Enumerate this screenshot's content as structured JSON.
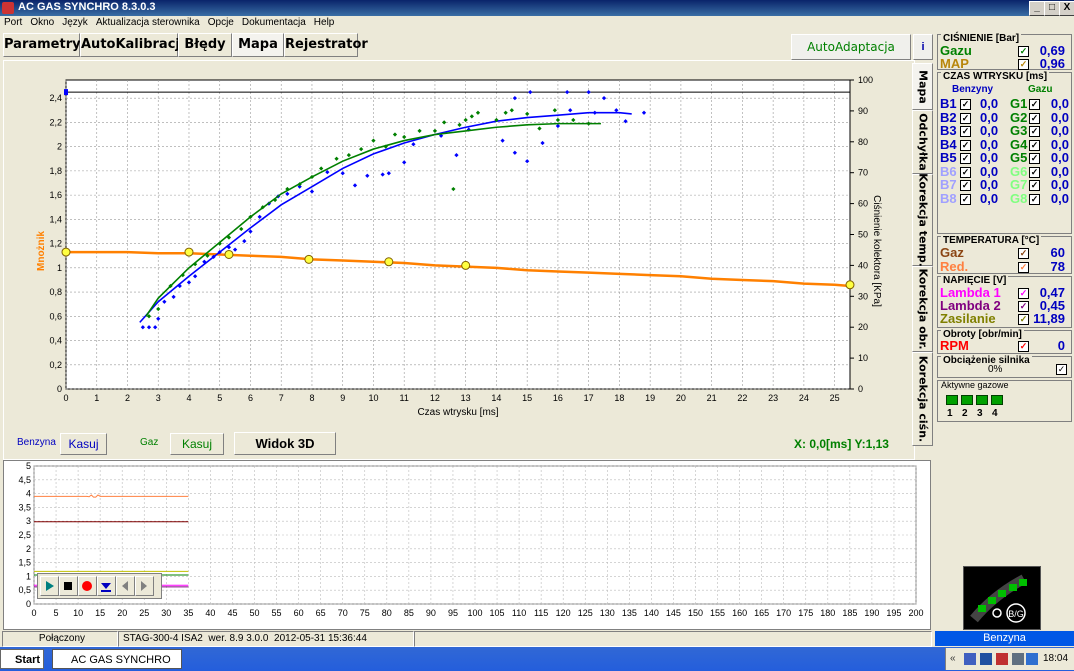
{
  "window": {
    "title": "AC GAS SYNCHRO  8.3.0.3",
    "btn_min": "_",
    "btn_max": "□",
    "btn_close": "X"
  },
  "menu": [
    "Port",
    "Okno",
    "Język",
    "Aktualizacja sterownika",
    "Opcje",
    "Dokumentacja",
    "Help"
  ],
  "tabs": [
    "Parametry",
    "AutoKalibracja",
    "Błędy",
    "Mapa",
    "Rejestrator"
  ],
  "active_tab": "Mapa",
  "autoadaptacja": "AutoAdaptacja",
  "info_btn": "i",
  "vtabs": [
    "Mapa",
    "Odchyłka",
    "Korekcja temp.",
    "Korekcja obr.",
    "Korekcja ciśn."
  ],
  "chart_labels": {
    "ylabel": "Mnożnik",
    "y2label": "Ciśnienie kolektora [KPa]",
    "xlabel": "Czas wtrysku [ms]"
  },
  "chart_controls": {
    "benzyna_label": "Benzyna",
    "kasuj1": "Kasuj",
    "gaz_label": "Gaz",
    "kasuj2": "Kasuj",
    "widok3d": "Widok 3D",
    "coords": "X:  0,0[ms] Y:1,13"
  },
  "chart_data": {
    "type": "scatter",
    "x_ticks": [
      0,
      1,
      2,
      3,
      4,
      5,
      6,
      7,
      8,
      9,
      10,
      11,
      12,
      13,
      14,
      15,
      16,
      17,
      18,
      19,
      20,
      21,
      22,
      23,
      24,
      25
    ],
    "y_ticks": [
      "0",
      "0,2",
      "0,4",
      "0,6",
      "0,8",
      "1",
      "1,2",
      "1,4",
      "1,6",
      "1,8",
      "2",
      "2,2",
      "2,4"
    ],
    "y2_ticks": [
      0,
      10,
      20,
      30,
      40,
      50,
      60,
      70,
      80,
      90,
      100
    ],
    "xlim": [
      0,
      25.5
    ],
    "ylim": [
      0,
      2.55
    ],
    "y2lim": [
      0,
      100
    ],
    "series": [
      {
        "color": "#0000FF",
        "trend": [
          [
            2.4,
            0.55
          ],
          [
            3,
            0.72
          ],
          [
            4,
            0.93
          ],
          [
            5,
            1.13
          ],
          [
            6,
            1.33
          ],
          [
            7,
            1.52
          ],
          [
            8,
            1.67
          ],
          [
            9,
            1.82
          ],
          [
            10,
            1.94
          ],
          [
            11,
            2.03
          ],
          [
            12,
            2.1
          ],
          [
            13,
            2.16
          ],
          [
            14,
            2.21
          ],
          [
            15,
            2.24
          ],
          [
            16,
            2.26
          ],
          [
            17,
            2.28
          ],
          [
            18,
            2.28
          ],
          [
            18.4,
            2.27
          ]
        ],
        "points": [
          [
            2.5,
            0.51
          ],
          [
            2.7,
            0.51
          ],
          [
            2.9,
            0.51
          ],
          [
            3,
            0.58
          ],
          [
            3.2,
            0.72
          ],
          [
            3.5,
            0.76
          ],
          [
            3.7,
            0.85
          ],
          [
            4,
            0.88
          ],
          [
            4.2,
            0.93
          ],
          [
            4.5,
            1.05
          ],
          [
            4.8,
            1.09
          ],
          [
            5,
            1.13
          ],
          [
            5.3,
            1.17
          ],
          [
            5.5,
            1.15
          ],
          [
            5.8,
            1.22
          ],
          [
            6,
            1.3
          ],
          [
            6.3,
            1.42
          ],
          [
            6.6,
            1.53
          ],
          [
            6.9,
            1.59
          ],
          [
            7.2,
            1.61
          ],
          [
            7.6,
            1.67
          ],
          [
            8,
            1.63
          ],
          [
            8.5,
            1.79
          ],
          [
            9,
            1.78
          ],
          [
            9.4,
            1.68
          ],
          [
            9.8,
            1.76
          ],
          [
            10.3,
            1.77
          ],
          [
            10.5,
            1.78
          ],
          [
            11,
            1.87
          ],
          [
            11.3,
            2.02
          ],
          [
            12.2,
            2.09
          ],
          [
            12.7,
            1.93
          ],
          [
            13.1,
            2.14
          ],
          [
            14.2,
            2.05
          ],
          [
            14.6,
            1.95
          ],
          [
            15,
            1.88
          ],
          [
            15.5,
            2.03
          ],
          [
            16,
            2.17
          ],
          [
            16.4,
            2.3
          ],
          [
            17.2,
            2.28
          ],
          [
            17.5,
            2.4
          ],
          [
            17.9,
            2.3
          ],
          [
            18.2,
            2.21
          ],
          [
            14.6,
            2.4
          ],
          [
            15.1,
            2.45
          ],
          [
            16.3,
            2.45
          ],
          [
            17,
            2.45
          ],
          [
            18.8,
            2.28
          ]
        ]
      },
      {
        "color": "#008000",
        "trend": [
          [
            2.6,
            0.6
          ],
          [
            3,
            0.75
          ],
          [
            4,
            1.0
          ],
          [
            5,
            1.21
          ],
          [
            6,
            1.42
          ],
          [
            7,
            1.61
          ],
          [
            8,
            1.75
          ],
          [
            9,
            1.88
          ],
          [
            10,
            1.98
          ],
          [
            11,
            2.05
          ],
          [
            12,
            2.1
          ],
          [
            13,
            2.13
          ],
          [
            14,
            2.16
          ],
          [
            15,
            2.18
          ],
          [
            16,
            2.19
          ],
          [
            17,
            2.19
          ],
          [
            17.4,
            2.19
          ]
        ],
        "points": [
          [
            2.7,
            0.6
          ],
          [
            3,
            0.66
          ],
          [
            3.4,
            0.85
          ],
          [
            3.8,
            0.94
          ],
          [
            4.2,
            1.03
          ],
          [
            4.6,
            1.1
          ],
          [
            5,
            1.2
          ],
          [
            5.3,
            1.25
          ],
          [
            5.7,
            1.32
          ],
          [
            6,
            1.42
          ],
          [
            6.4,
            1.5
          ],
          [
            6.8,
            1.56
          ],
          [
            7.2,
            1.65
          ],
          [
            7.6,
            1.69
          ],
          [
            8,
            1.75
          ],
          [
            8.3,
            1.82
          ],
          [
            8.8,
            1.9
          ],
          [
            9.2,
            1.93
          ],
          [
            9.6,
            1.98
          ],
          [
            10,
            2.05
          ],
          [
            10.4,
            2.0
          ],
          [
            11,
            2.08
          ],
          [
            11.5,
            2.13
          ],
          [
            12,
            2.13
          ],
          [
            12.3,
            2.2
          ],
          [
            12.8,
            2.18
          ],
          [
            13,
            2.22
          ],
          [
            13.4,
            2.28
          ],
          [
            14,
            2.22
          ],
          [
            14.5,
            2.3
          ],
          [
            15,
            2.27
          ],
          [
            15.4,
            2.15
          ],
          [
            16,
            2.22
          ],
          [
            16.5,
            2.22
          ],
          [
            17,
            2.19
          ],
          [
            10.7,
            2.1
          ],
          [
            12.6,
            1.65
          ],
          [
            13.2,
            2.25
          ],
          [
            14.3,
            2.28
          ],
          [
            15.9,
            2.3
          ]
        ]
      }
    ],
    "petrol_line": {
      "color": "#FF8000",
      "points": [
        [
          0,
          1.13
        ],
        [
          1,
          1.13
        ],
        [
          2,
          1.13
        ],
        [
          3,
          1.12
        ],
        [
          4,
          1.12
        ],
        [
          5,
          1.11
        ],
        [
          6,
          1.1
        ],
        [
          7,
          1.09
        ],
        [
          8,
          1.07
        ],
        [
          9,
          1.06
        ],
        [
          10,
          1.05
        ],
        [
          11,
          1.04
        ],
        [
          12,
          1.02
        ],
        [
          13,
          1.01
        ],
        [
          14,
          1.0
        ],
        [
          15,
          0.98
        ],
        [
          16,
          0.97
        ],
        [
          17,
          0.96
        ],
        [
          18,
          0.95
        ],
        [
          19,
          0.94
        ],
        [
          20,
          0.93
        ],
        [
          21,
          0.91
        ],
        [
          22,
          0.9
        ],
        [
          23,
          0.89
        ],
        [
          24,
          0.87
        ],
        [
          25,
          0.86
        ],
        [
          25.5,
          0.85
        ]
      ],
      "markers": [
        [
          0,
          1.13
        ],
        [
          4,
          1.13
        ],
        [
          5.3,
          1.11
        ],
        [
          7.9,
          1.07
        ],
        [
          10.5,
          1.05
        ],
        [
          13,
          1.02
        ],
        [
          25.5,
          0.86
        ]
      ]
    },
    "ref_line": {
      "y": 2.45,
      "color": "#000000"
    }
  },
  "bottom_chart": {
    "y_ticks": [
      "0",
      "0,5",
      "1",
      "1,5",
      "2",
      "2,5",
      "3",
      "3,5",
      "4",
      "4,5",
      "5"
    ],
    "x_ticks": [
      0,
      5,
      10,
      15,
      20,
      25,
      30,
      35,
      40,
      45,
      50,
      55,
      60,
      65,
      70,
      75,
      80,
      85,
      90,
      95,
      100,
      105,
      110,
      115,
      120,
      125,
      130,
      135,
      140,
      145,
      150,
      155,
      160,
      165,
      170,
      175,
      180,
      185,
      190,
      195,
      200
    ],
    "xlim": [
      0,
      200
    ],
    "ylim": [
      0,
      5
    ],
    "lines": [
      {
        "color": "#FF8040",
        "y": 3.9
      },
      {
        "color": "#800000",
        "y": 2.98
      },
      {
        "color": "#C0C000",
        "y": 1.18
      },
      {
        "color": "#008000",
        "y": 1.05
      },
      {
        "color": "#FF00FF",
        "y": 0.68
      },
      {
        "color": "#800080",
        "y": 0.62
      }
    ],
    "line_end_x": 35
  },
  "status": {
    "conn": "Połączony",
    "ecu": "STAG-300-4 ISA2",
    "ver": "wer. 8.9  3.0.0",
    "date": "2012-05-31 15:36:44",
    "fuel": "Benzyna"
  },
  "right": {
    "cisn_title": "CIŚNIENIE [Bar]",
    "gazu_label": "Gazu",
    "gazu_val": "0,69",
    "map_label": "MAP",
    "map_val": "0,96",
    "czas_title": "CZAS WTRYSKU [ms]",
    "benzyny": "Benzyny",
    "gazu": "Gazu",
    "inj": [
      {
        "b": "B1",
        "bv": "0,0",
        "g": "G1",
        "gv": "0,0"
      },
      {
        "b": "B2",
        "bv": "0,0",
        "g": "G2",
        "gv": "0,0"
      },
      {
        "b": "B3",
        "bv": "0,0",
        "g": "G3",
        "gv": "0,0"
      },
      {
        "b": "B4",
        "bv": "0,0",
        "g": "G4",
        "gv": "0,0"
      },
      {
        "b": "B5",
        "bv": "0,0",
        "g": "G5",
        "gv": "0,0"
      },
      {
        "b": "B6",
        "bv": "0,0",
        "g": "G6",
        "gv": "0,0"
      },
      {
        "b": "B7",
        "bv": "0,0",
        "g": "G7",
        "gv": "0,0"
      },
      {
        "b": "B8",
        "bv": "0,0",
        "g": "G8",
        "gv": "0,0"
      }
    ],
    "temp_title": "TEMPERATURA [°C]",
    "gaz_label": "Gaz",
    "gaz_val": "60",
    "red_label": "Red.",
    "red_val": "78",
    "nap_title": "NAPIĘCIE [V]",
    "l1_label": "Lambda 1",
    "l1_val": "0,47",
    "l2_label": "Lambda 2",
    "l2_val": "0,45",
    "zas_label": "Zasilanie",
    "zas_val": "11,89",
    "obr_title": "Obroty [obr/min]",
    "rpm_label": "RPM",
    "rpm_val": "0",
    "obc_title": "Obciążenie silnika",
    "obc_val": "0%",
    "akt_title": "Aktywne gazowe",
    "akt_nums": [
      "1",
      "2",
      "3",
      "4"
    ],
    "bg_label": "B/G"
  },
  "taskbar": {
    "start": "Start",
    "task": "AC GAS SYNCHRO",
    "time": "18:04"
  },
  "colors": {
    "injector_on": "#0000C0",
    "injector_off": "#A0A0FF",
    "gas_on": "#008000",
    "gas_off": "#80FF80"
  }
}
